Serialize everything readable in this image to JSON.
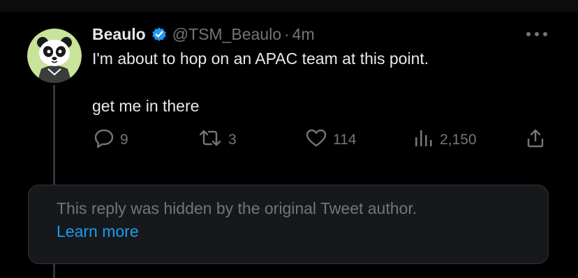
{
  "colors": {
    "background": "#000000",
    "text_primary": "#e7e9ea",
    "text_secondary": "#71767b",
    "accent_blue": "#1d9bf0",
    "verified_blue": "#1d9bf0",
    "card_background": "#16181c",
    "border": "#2f3336"
  },
  "tweet": {
    "display_name": "Beaulo",
    "handle": "@TSM_Beaulo",
    "separator": "·",
    "time": "4m",
    "verified_icon": "verified-badge-icon",
    "avatar_icon": "panda-avatar",
    "text_line_1": "I'm about to hop on an APAC team at this point.",
    "text_line_2": "get me in there",
    "actions": {
      "reply": {
        "icon": "reply-icon",
        "count": "9"
      },
      "retweet": {
        "icon": "retweet-icon",
        "count": "3"
      },
      "like": {
        "icon": "heart-icon",
        "count": "114"
      },
      "views": {
        "icon": "views-icon",
        "count": "2,150"
      },
      "share": {
        "icon": "share-icon"
      }
    },
    "more_icon": "more-options-icon"
  },
  "hidden_reply": {
    "message": "This reply was hidden by the original Tweet author.",
    "link": "Learn more"
  }
}
